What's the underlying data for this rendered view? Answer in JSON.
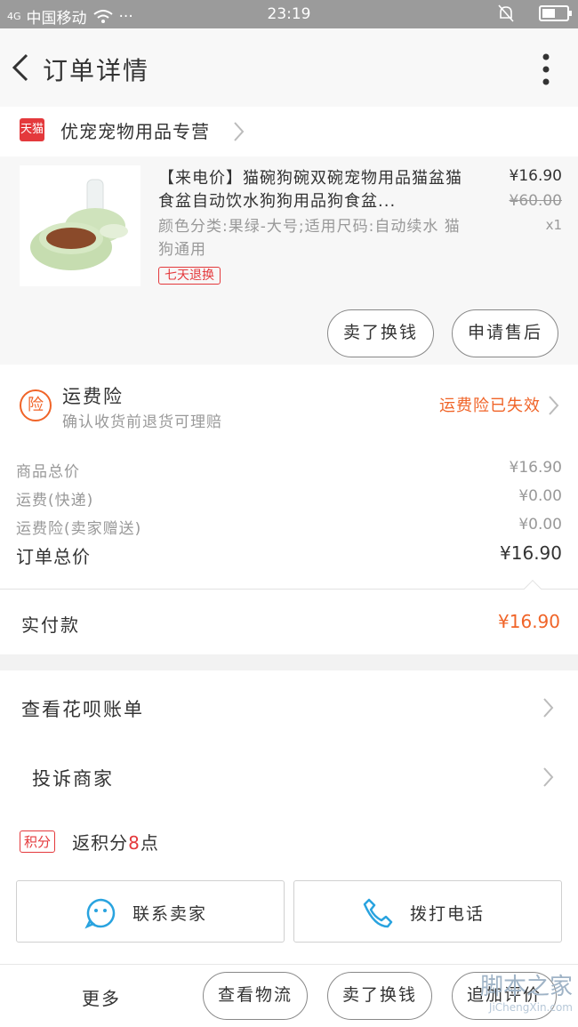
{
  "status_bar": {
    "signal": "4G",
    "carrier": "中国移动",
    "more": "···",
    "time": "23:19"
  },
  "header": {
    "title": "订单详情"
  },
  "store": {
    "badge": "天猫",
    "name": "优宠宠物用品专营"
  },
  "product": {
    "title": "【来电价】猫碗狗碗双碗宠物用品猫盆猫食盆自动饮水狗狗用品狗食盆...",
    "spec": "颜色分类:果绿-大号;适用尺码:自动续水 猫狗通用",
    "tag": "七天退换",
    "price": "¥16.90",
    "original_price": "¥60.00",
    "quantity": "x1",
    "actions": [
      "卖了换钱",
      "申请售后"
    ]
  },
  "insurance": {
    "icon_text": "险",
    "title": "运费险",
    "desc": "确认收货前退货可理赔",
    "status": "运费险已失效"
  },
  "summary": {
    "rows": [
      {
        "label": "商品总价",
        "value": "¥16.90"
      },
      {
        "label": "运费(快递)",
        "value": "¥0.00"
      },
      {
        "label": "运费险(卖家赠送)",
        "value": "¥0.00"
      }
    ],
    "total_label": "订单总价",
    "total_value": "¥16.90"
  },
  "paid": {
    "label": "实付款",
    "value": "¥16.90"
  },
  "links": {
    "huabei": "查看花呗账单",
    "complain": "投诉商家"
  },
  "points": {
    "badge": "积分",
    "prefix": "返积分",
    "number": "8",
    "suffix": "点"
  },
  "contact": {
    "contact_label": "联系卖家",
    "call_label": "拨打电话"
  },
  "bottom_bar": {
    "more": "更多",
    "logistics": "查看物流",
    "sell": "卖了换钱",
    "review": "追加评价"
  },
  "watermark": {
    "logo": "脚本之家",
    "url": "JiChengXin.com"
  },
  "colors": {
    "accent_orange": "#f06428",
    "tmall_red": "#e4393c",
    "status_bar": "#9b9b9b",
    "chat_blue": "#29a3df"
  }
}
